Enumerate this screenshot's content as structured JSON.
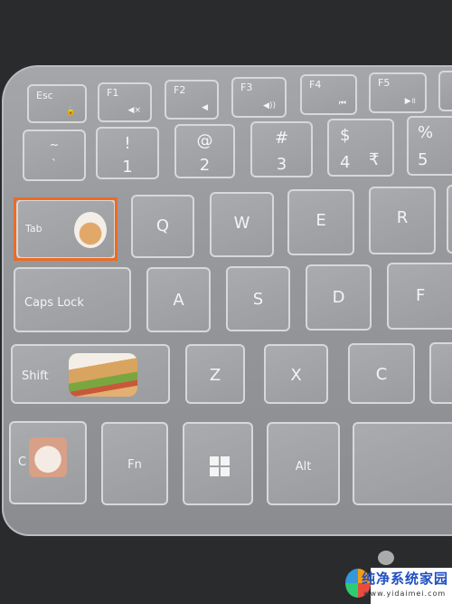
{
  "keys": {
    "esc": "Esc",
    "f1": "F1",
    "f2": "F2",
    "f3": "F3",
    "f4": "F4",
    "f5": "F5",
    "tilde": "~",
    "backtick": "`",
    "exclam": "!",
    "one": "1",
    "at": "@",
    "two": "2",
    "hash": "#",
    "three": "3",
    "dollar": "$",
    "four": "4",
    "rupee": "₹",
    "percent": "%",
    "five": "5",
    "tab": "Tab",
    "q": "Q",
    "w": "W",
    "e": "E",
    "r": "R",
    "caps": "Caps Lock",
    "a": "A",
    "s": "S",
    "d": "D",
    "f": "F",
    "shift": "Shift",
    "z": "Z",
    "x": "X",
    "c": "C",
    "ctrl": "C",
    "fn": "Fn",
    "alt": "Alt"
  },
  "fn_icons": {
    "esc": "lock-icon",
    "f1": "mute-icon",
    "f2": "volume-down-icon",
    "f3": "volume-up-icon",
    "f4": "previous-track-icon",
    "f5": "play-pause-icon"
  },
  "highlight_color": "#ef6a24",
  "watermark": {
    "title": "纯净系统家园",
    "url": "www.yidaimei.com"
  }
}
